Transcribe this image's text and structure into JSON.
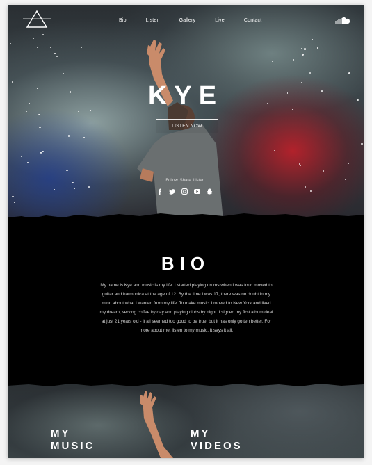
{
  "nav": {
    "items": [
      "Bio",
      "Listen",
      "Gallery",
      "Live",
      "Contact"
    ]
  },
  "icons": {
    "logo": "triangle-logo-icon",
    "cloud": "soundcloud-icon",
    "social": [
      "facebook-icon",
      "twitter-icon",
      "instagram-icon",
      "youtube-icon",
      "snapchat-icon"
    ]
  },
  "hero": {
    "title": "KYE",
    "button_label": "LISTEN NOW",
    "follow_text": "Follow. Share. Listen."
  },
  "bio": {
    "title": "BIO",
    "lines": [
      "My name is Kye and music is my life. I started playing drums when I was four, moved to",
      "guitar and harmonica at the age of 12. By the time I was 17, there was no doubt in my",
      "mind about what I wanted from my life. To make music. I moved to New York and lived",
      "my dream, serving coffee by day and playing clubs by night. I signed my first album deal",
      "at just 21 years old - it all seemed too good to be true, but it has only gotten better. For",
      "more about me, listen to my music. It says it all."
    ]
  },
  "sections": {
    "music_line1": "MY",
    "music_line2": "MUSIC",
    "videos_line1": "MY",
    "videos_line2": "VIDEOS"
  },
  "colors": {
    "background": "#000000",
    "text": "#ffffff",
    "accent_red": "#c81e28"
  }
}
